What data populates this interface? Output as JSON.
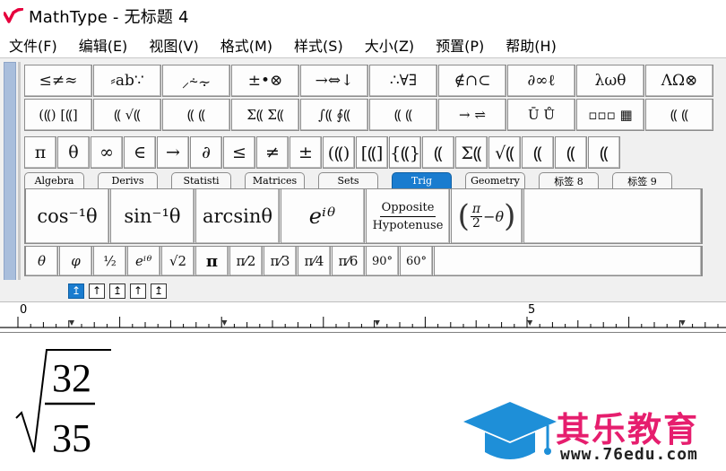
{
  "window": {
    "title": "MathType - 无标题 4",
    "accent": "#e6003d"
  },
  "menu": [
    "文件(F)",
    "编辑(E)",
    "视图(V)",
    "格式(M)",
    "样式(S)",
    "大小(Z)",
    "预置(P)",
    "帮助(H)"
  ],
  "toolbar": {
    "row1": [
      "≤≠≈",
      "⸗ab∵",
      "⸝⸞⸟",
      "±•⊗",
      "→⇔↓",
      "∴∀∃",
      "∉∩⊂",
      "∂∞ℓ",
      "λωθ",
      "ΛΩ⊗"
    ],
    "row2": [
      "(⸨) [⸨]",
      "⸨ √⸨",
      "⸨ ⸨",
      "Σ⸨ Σ⸨",
      "∫⸨ ∮⸨",
      "⸨ ⸨",
      "→ ⇌",
      "Ū Ů",
      "▫▫▫ ▦",
      "⸨ ⸨"
    ],
    "row3": [
      "π",
      "θ",
      "∞",
      "∈",
      "→",
      "∂",
      "≤",
      "≠",
      "±",
      "(⸨)",
      "[⸨]",
      "{⸨}",
      "⸨",
      "Σ⸨",
      "√⸨",
      "⸨",
      "⸨",
      "⸨"
    ],
    "tabs": [
      "Algebra",
      "Derivs",
      "Statisti",
      "Matrices",
      "Sets",
      "Trig",
      "Geometry",
      "标签 8",
      "标签 9"
    ],
    "active_tab": "Trig",
    "active_color": "#1a7ccf",
    "trig": [
      "cos⁻¹θ",
      "sin⁻¹θ",
      "arcsinθ",
      "eⁱᶿ",
      "Opposite",
      "Hypotenuse",
      "π",
      "2",
      "−θ"
    ],
    "symbols": [
      "θ",
      "φ",
      "½",
      "eⁱᶿ",
      "√2",
      "π",
      "π⁄2",
      "π⁄3",
      "π⁄4",
      "π⁄6",
      "90°",
      "60°"
    ]
  },
  "nudge": [
    "↥",
    "↑",
    "↥",
    "↑",
    "↥"
  ],
  "ruler": {
    "start": "0",
    "mid": "5"
  },
  "equation": {
    "numerator": "32",
    "denominator": "35"
  },
  "watermark": {
    "brand": "其乐教育",
    "url": "www.76edu.com",
    "brand_color": "#e61e6e",
    "cap_color": "#1e8fd8"
  }
}
